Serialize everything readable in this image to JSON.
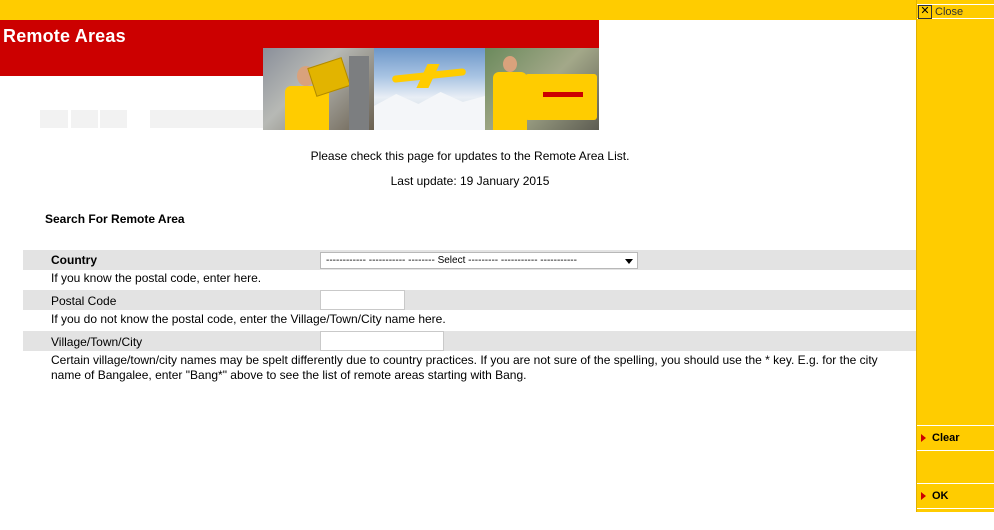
{
  "header": {
    "title": "Remote Areas",
    "close_label": "Close",
    "close_glyph": "✕"
  },
  "side_actions": {
    "clear_label": "Clear",
    "ok_label": "OK"
  },
  "info": {
    "update_notice": "Please check this page for updates to the Remote Area List.",
    "last_update": "Last update: 19 January 2015"
  },
  "form": {
    "heading": "Search For Remote Area",
    "country_label": "Country",
    "country_select_value": "------------ ----------- -------- Select --------- ----------- -----------",
    "country_note": "If you know the postal code, enter here.",
    "postal_label": "Postal Code",
    "postal_value": "",
    "postal_note": "If you do not know the postal code, enter the Village/Town/City name here.",
    "village_label": "Village/Town/City",
    "village_value": "",
    "village_note": "Certain village/town/city names may be spelt differently due to country practices. If you are not sure of the spelling, you should use the * key. E.g. for the city name of Bangalee, enter \"Bang*\" above to see the list of remote areas starting with Bang."
  },
  "colors": {
    "brand_yellow": "#ffcc00",
    "brand_red": "#cc0000",
    "row_gray": "#e3e3e3"
  },
  "icons": {
    "close": "close-icon",
    "clear_arrow": "triangle-right-icon",
    "ok_arrow": "triangle-right-icon"
  }
}
